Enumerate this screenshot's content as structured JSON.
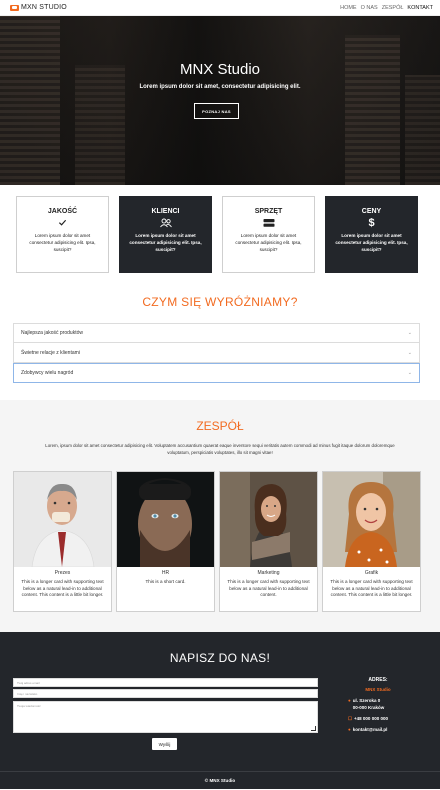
{
  "nav": {
    "brand": "MXN STUDIO",
    "links": [
      "HOME",
      "O NAS",
      "ZESPÓŁ",
      "KONTAKT"
    ]
  },
  "hero": {
    "title": "MNX Studio",
    "subtitle": "Lorem ipsum dolor sit amet, consectetur adipisicing elit.",
    "button": "POZNAJ NAS"
  },
  "features": [
    {
      "title": "JAKOŚĆ",
      "icon": "check-icon",
      "text": "Lorem ipsum dolor sit amet consectetur adipisicing elit. Ipsa, suscipit?"
    },
    {
      "title": "KLIENCI",
      "icon": "users-icon",
      "text": "Lorem ipsum dolor sit amet consectetur adipisicing elit. Ipsa, suscipit?"
    },
    {
      "title": "SPRZĘT",
      "icon": "server-icon",
      "text": "Lorem ipsum dolor sit amet consectetur adipisicing elit. Ipsa, suscipit?"
    },
    {
      "title": "CENY",
      "icon": "dollar-icon",
      "text": "Lorem ipsum dolor sit amet consectetur adipisicing elit. Ipsa, suscipit?"
    }
  ],
  "why": {
    "title": "CZYM SIĘ WYRÓŻNIAMY?",
    "items": [
      "Najlepsza jakość produktów",
      "Świetne relacje z klientami",
      "Zdobywcy wielu nagród"
    ]
  },
  "team": {
    "title": "ZESPÓŁ",
    "text": "Lorem, ipsum dolor sit amet consectetur adipisicing elit. Voluptatem accusantium quaerat eaque inventore sequi veritatis autem commodi ad minus fugit itaque dolorum doloremque voluptatum, perspiciatis voluptates, illo sit magni vitae!",
    "members": [
      {
        "role": "Prezes",
        "desc": "This is a longer card with supporting text below as a natural lead-in to additional content. This content is a little bit longer."
      },
      {
        "role": "HR",
        "desc": "This is a short card."
      },
      {
        "role": "Marketing",
        "desc": "This is a longer card with supporting text below as a natural lead-in to additional content."
      },
      {
        "role": "Grafik",
        "desc": "This is a longer card with supporting text below as a natural lead-in to additional content. This content is a little bit longer."
      }
    ]
  },
  "contact": {
    "title": "NAPISZ DO NAS!",
    "email_placeholder": "Twój adres email",
    "name_placeholder": "Imię i nazwisko",
    "message_placeholder": "Twoja wiadomość",
    "send": "Wyślij",
    "address_title": "ADRES:",
    "address_brand": "MNX Studio",
    "street": "ul. Szeroka 0",
    "city": "00-000 Kraków",
    "phone": "+48 000 000 000",
    "email": "kontakt@mail.pl"
  },
  "footer": {
    "copyright": "© MNX Studio"
  },
  "colors": {
    "accent": "#f26b21",
    "dark": "#23262b"
  }
}
